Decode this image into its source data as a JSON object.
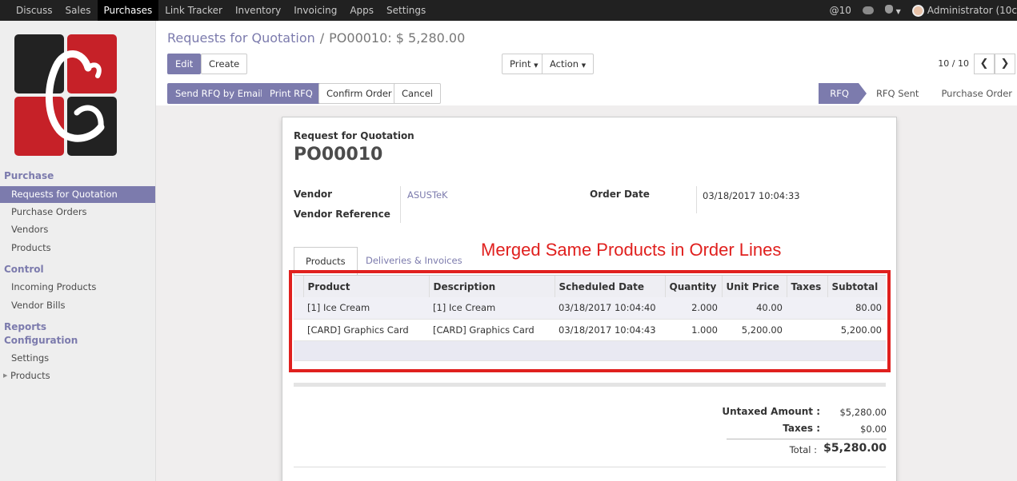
{
  "topbar": {
    "menu": [
      "Discuss",
      "Sales",
      "Purchases",
      "Link Tracker",
      "Inventory",
      "Invoicing",
      "Apps",
      "Settings"
    ],
    "active_menu": "Purchases",
    "mentions": "@10",
    "user": "Administrator (10c"
  },
  "sidebar": {
    "sections": {
      "purchase": "Purchase",
      "control": "Control",
      "reports": "Reports",
      "configuration": "Configuration"
    },
    "items": {
      "rfq": "Requests for Quotation",
      "purchase_orders": "Purchase Orders",
      "vendors": "Vendors",
      "products": "Products",
      "incoming_products": "Incoming Products",
      "vendor_bills": "Vendor Bills",
      "settings": "Settings",
      "config_products": "Products"
    }
  },
  "breadcrumb": {
    "parent": "Requests for Quotation",
    "separator": "/",
    "current": "PO00010: $ 5,280.00"
  },
  "buttons": {
    "edit": "Edit",
    "create": "Create",
    "print": "Print",
    "action": "Action",
    "send_rfq": "Send RFQ by Email",
    "print_rfq": "Print RFQ",
    "confirm": "Confirm Order",
    "cancel": "Cancel"
  },
  "pager": {
    "text": "10 / 10"
  },
  "stages": [
    "RFQ",
    "RFQ Sent",
    "Purchase Order"
  ],
  "current_stage": "RFQ",
  "form": {
    "doc_type": "Request for Quotation",
    "doc_name": "PO00010",
    "vendor_label": "Vendor",
    "vendor_value": "ASUSTeK",
    "vendor_ref_label": "Vendor Reference",
    "order_date_label": "Order Date",
    "order_date_value": "03/18/2017 10:04:33"
  },
  "tabs": [
    "Products",
    "Deliveries & Invoices"
  ],
  "annotation": "Merged Same Products in Order Lines",
  "lines": {
    "headers": [
      "Product",
      "Description",
      "Scheduled Date",
      "Quantity",
      "Unit Price",
      "Taxes",
      "Subtotal"
    ],
    "rows": [
      [
        "[1] Ice Cream",
        "[1] Ice Cream",
        "03/18/2017 10:04:40",
        "2.000",
        "40.00",
        "",
        "80.00"
      ],
      [
        "[CARD] Graphics Card",
        "[CARD] Graphics Card",
        "03/18/2017 10:04:43",
        "1.000",
        "5,200.00",
        "",
        "5,200.00"
      ]
    ]
  },
  "totals": {
    "untaxed_label": "Untaxed Amount :",
    "untaxed_value": "$5,280.00",
    "taxes_label": "Taxes :",
    "taxes_value": "$0.00",
    "total_label": "Total :",
    "total_value": "$5,280.00"
  },
  "colors": {
    "accent": "#7c7bad",
    "annotation": "#e0201e",
    "topbar": "#212121"
  }
}
